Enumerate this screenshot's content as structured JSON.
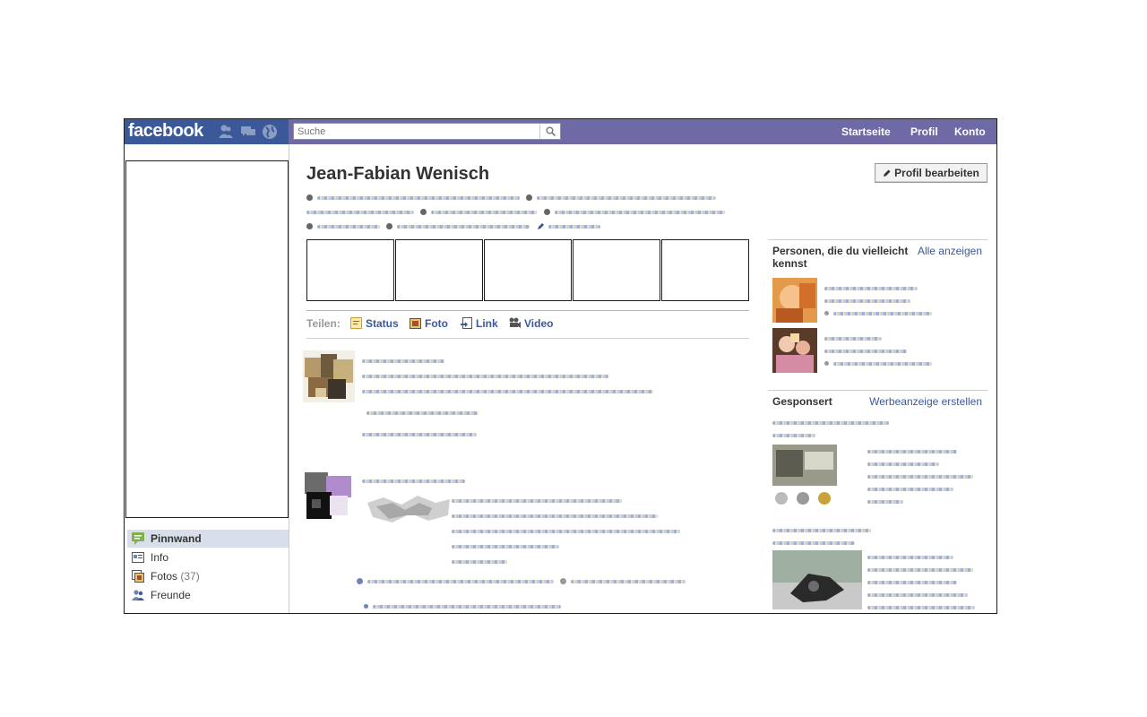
{
  "topbar": {
    "logo": "facebook",
    "search_placeholder": "Suche",
    "nav": [
      "Startseite",
      "Profil",
      "Konto"
    ],
    "brand_color": "#3b5998",
    "bar_color": "#6d6aa6"
  },
  "profile": {
    "name": "Jean-Fabian Wenisch",
    "edit_button": "Profil bearbeiten"
  },
  "sidebar": {
    "items": [
      {
        "label": "Pinnwand",
        "icon": "wall-icon"
      },
      {
        "label": "Info",
        "icon": "info-icon"
      },
      {
        "label": "Fotos",
        "count": "(37)",
        "icon": "photos-icon"
      },
      {
        "label": "Freunde",
        "icon": "friends-icon"
      }
    ]
  },
  "share": {
    "label": "Teilen:",
    "items": [
      {
        "label": "Status",
        "icon": "status-icon"
      },
      {
        "label": "Foto",
        "icon": "photo-icon"
      },
      {
        "label": "Link",
        "icon": "link-icon"
      },
      {
        "label": "Video",
        "icon": "video-icon"
      }
    ]
  },
  "suggestions": {
    "title": "Personen, die du vielleicht kennst",
    "link": "Alle anzeigen"
  },
  "ads": {
    "title": "Gesponsert",
    "link": "Werbeanzeige erstellen"
  }
}
